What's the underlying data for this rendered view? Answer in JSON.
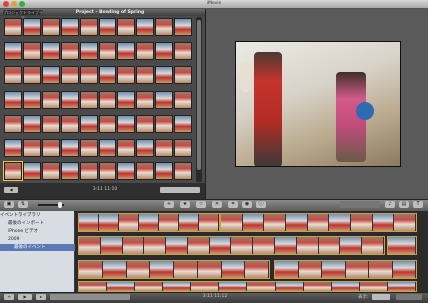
{
  "window": {
    "app_title": "iMovie"
  },
  "project": {
    "library_button": "プロジェクトライブラリ",
    "title": "Project – Bowling of Spring",
    "duration": "3:11 11:10"
  },
  "event_library": {
    "header": "イベントライブラリ",
    "items": [
      {
        "label": "最後のインポート",
        "selected": false
      },
      {
        "label": "iPhone ビデオ",
        "selected": false
      },
      {
        "label": "2009",
        "selected": false
      },
      {
        "label": "最後のイベント",
        "selected": true
      }
    ]
  },
  "bottom_bar": {
    "status": "3:11 11:12",
    "show_label": "表示:"
  },
  "colors": {
    "selection": "#f4c542",
    "sidebar_selected": "#5a79b5"
  }
}
